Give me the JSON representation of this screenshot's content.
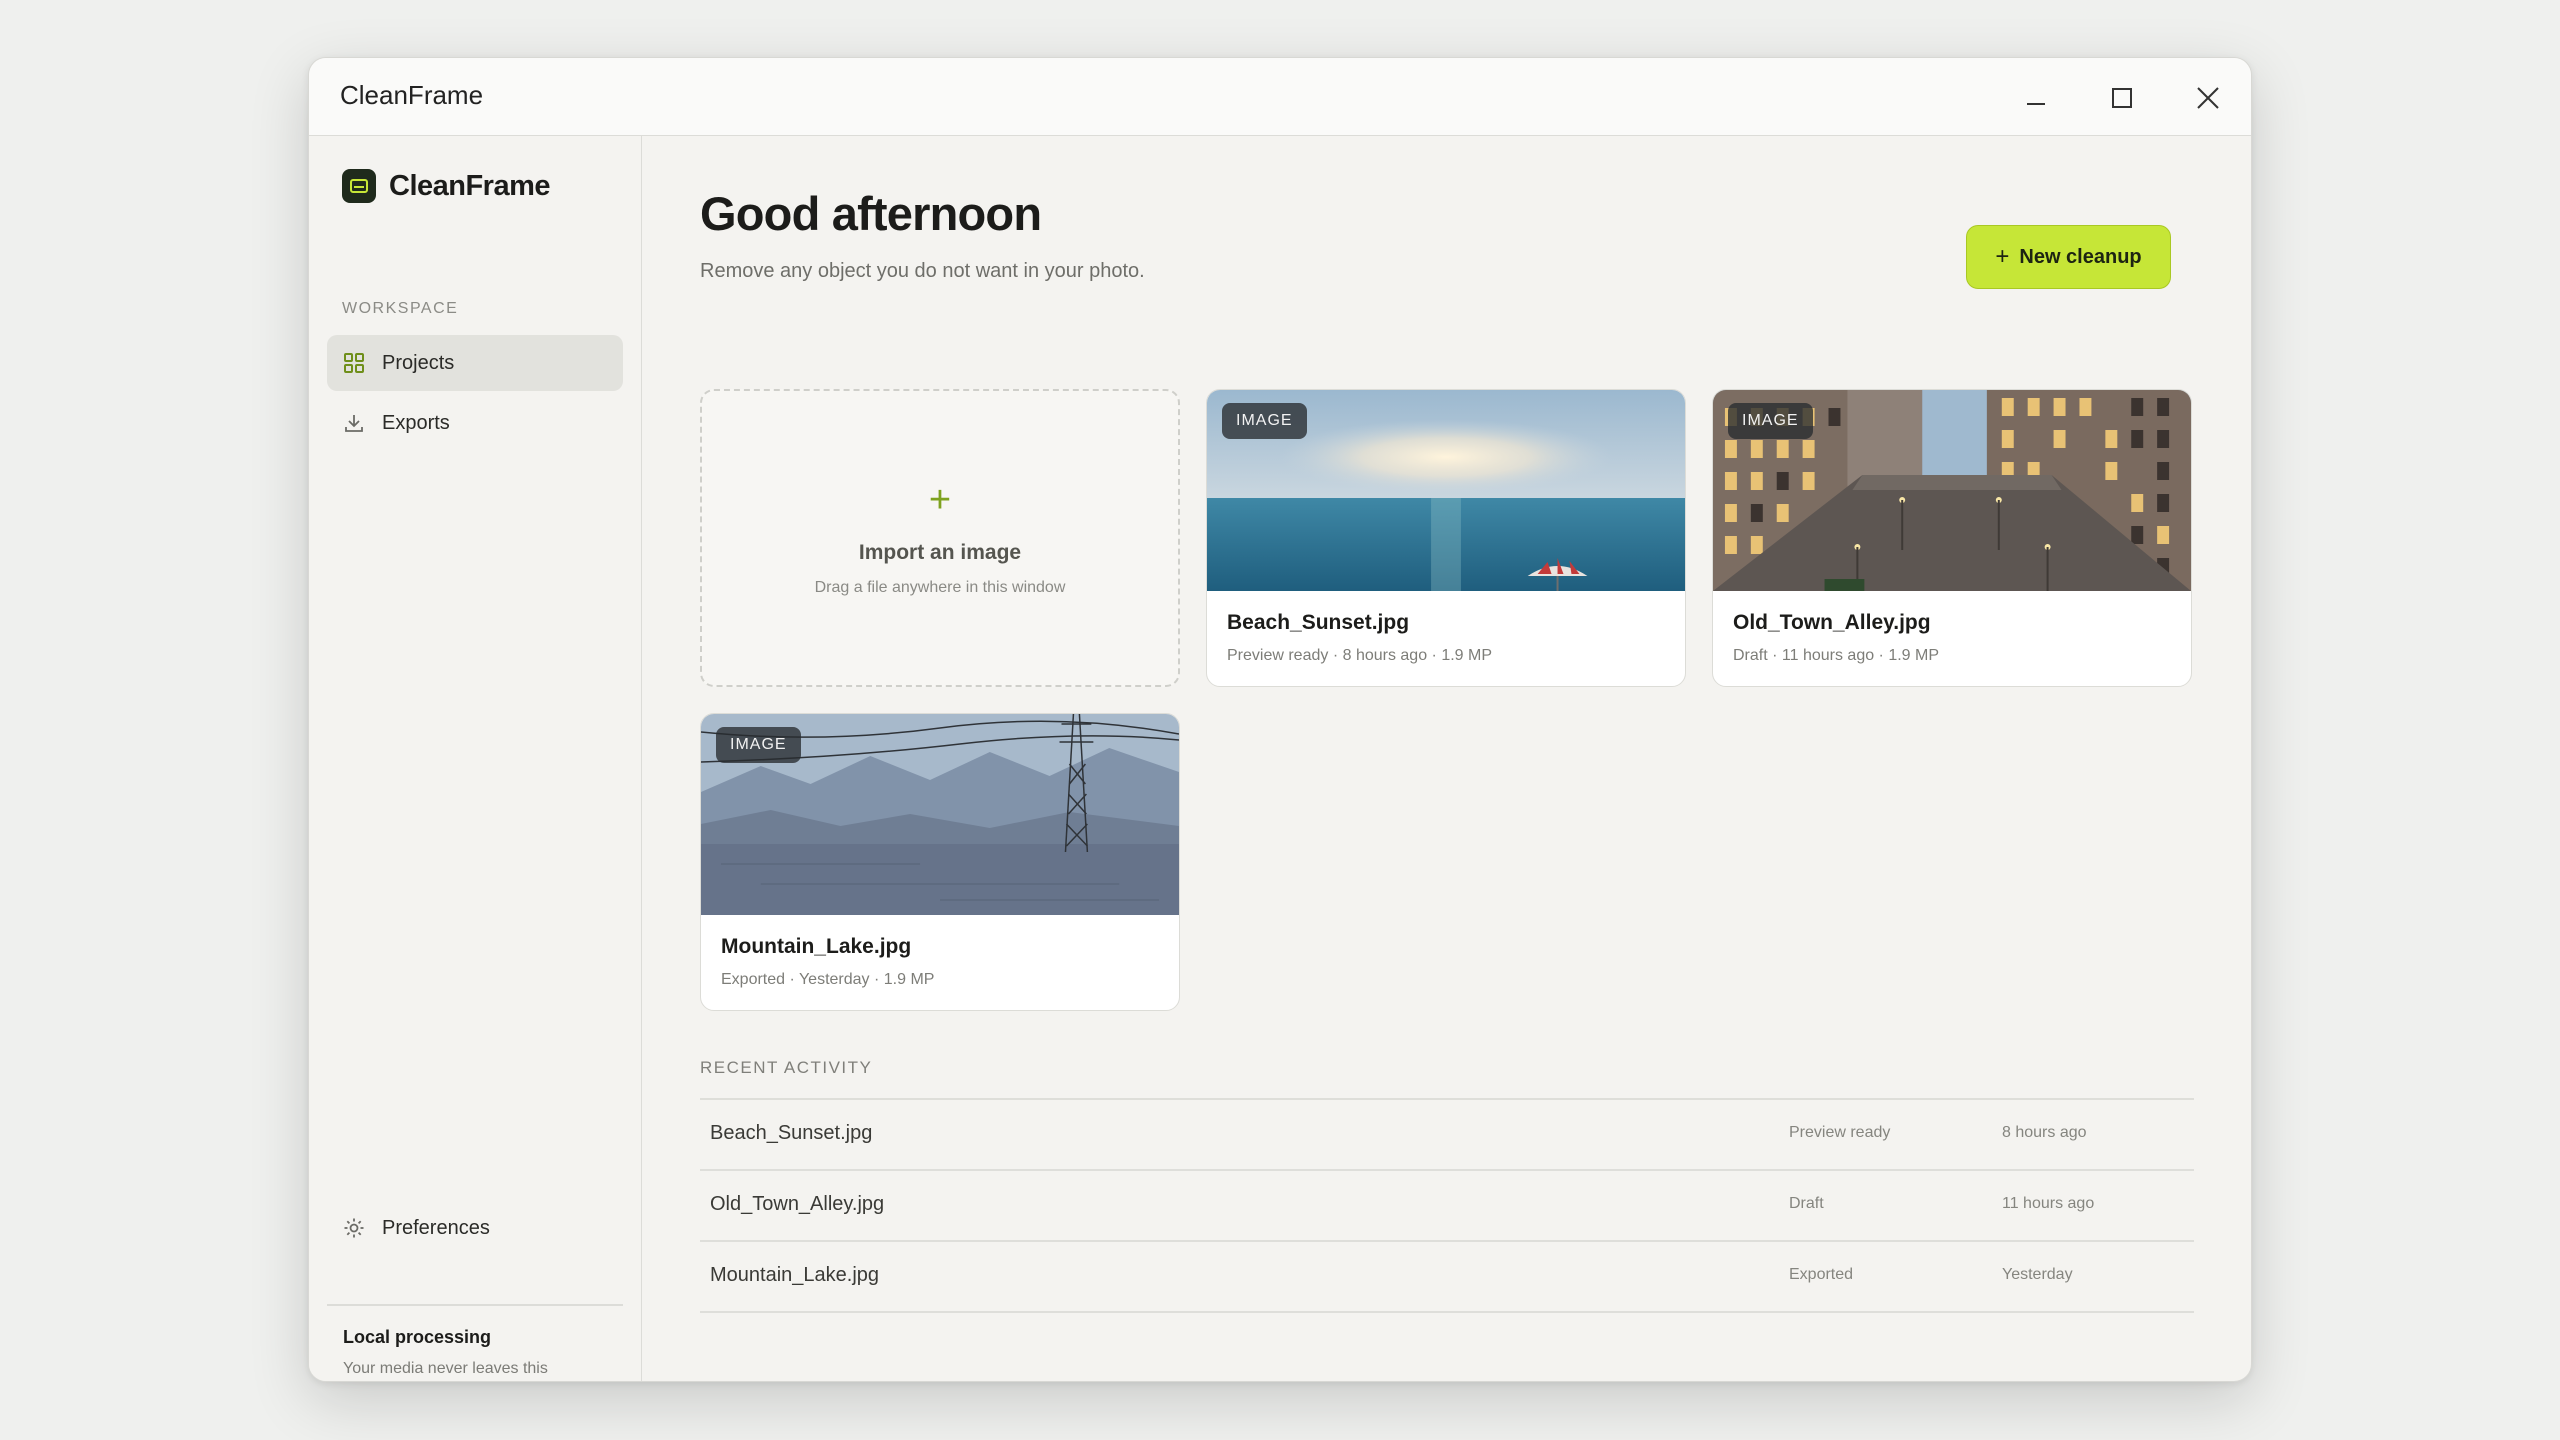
{
  "window": {
    "title": "CleanFrame"
  },
  "sidebar": {
    "brand": "CleanFrame",
    "section_label": "WORKSPACE",
    "items": [
      {
        "label": "Projects",
        "icon": "grid-icon",
        "active": true
      },
      {
        "label": "Exports",
        "icon": "download-icon",
        "active": false
      }
    ],
    "preferences_label": "Preferences",
    "local_title": "Local processing",
    "local_desc": "Your media never leaves this computer."
  },
  "main": {
    "greeting": "Good afternoon",
    "subtitle": "Remove any object you do not want in your photo.",
    "new_button_label": "New cleanup",
    "import": {
      "plus": "+",
      "title": "Import an image",
      "subtitle": "Drag a file anywhere in this window"
    },
    "projects": [
      {
        "badge": "IMAGE",
        "name": "Beach_Sunset.jpg",
        "meta": "Preview ready · 8 hours ago · 1.9 MP"
      },
      {
        "badge": "IMAGE",
        "name": "Old_Town_Alley.jpg",
        "meta": "Draft · 11 hours ago · 1.9 MP"
      },
      {
        "badge": "IMAGE",
        "name": "Mountain_Lake.jpg",
        "meta": "Exported · Yesterday · 1.9 MP"
      }
    ],
    "recent_label": "RECENT ACTIVITY",
    "recent": [
      {
        "name": "Beach_Sunset.jpg",
        "status": "Preview ready",
        "time": "8 hours ago"
      },
      {
        "name": "Old_Town_Alley.jpg",
        "status": "Draft",
        "time": "11 hours ago"
      },
      {
        "name": "Mountain_Lake.jpg",
        "status": "Exported",
        "time": "Yesterday"
      }
    ]
  },
  "colors": {
    "accent": "#c6e637",
    "accent_text": "#7ea21e",
    "background": "#f4f3f0"
  }
}
